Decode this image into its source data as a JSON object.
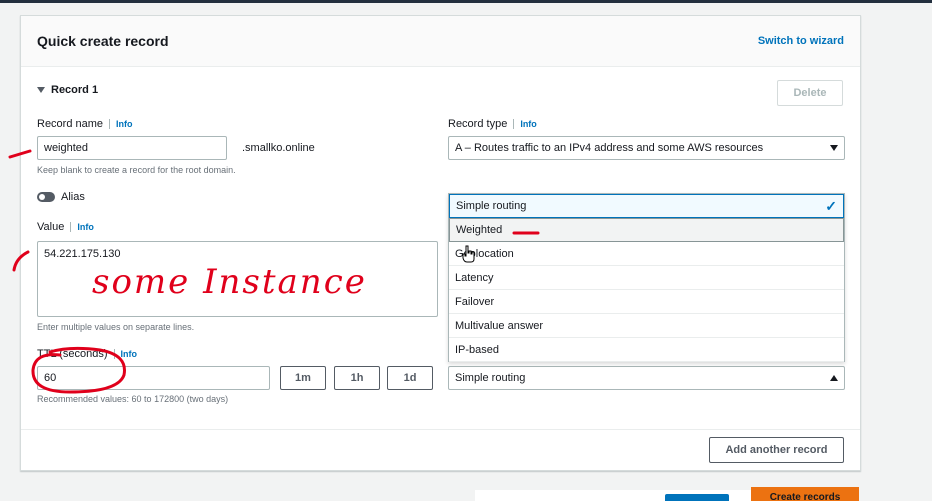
{
  "panel": {
    "title": "Quick create record",
    "switch_link": "Switch to wizard"
  },
  "record": {
    "title": "Record 1",
    "delete_label": "Delete",
    "name_label": "Record name",
    "name_info": "Info",
    "name_value": "weighted",
    "domain_suffix": ".smallko.online",
    "name_hint": "Keep blank to create a record for the root domain.",
    "type_label": "Record type",
    "type_info": "Info",
    "type_value": "A – Routes traffic to an IPv4 address and some AWS resources",
    "alias_label": "Alias",
    "value_label": "Value",
    "value_info": "Info",
    "value_text": "54.221.175.130",
    "value_hint": "Enter multiple values on separate lines.",
    "ttl_label": "TTL (seconds)",
    "ttl_info": "Info",
    "ttl_value": "60",
    "ttl_1m": "1m",
    "ttl_1h": "1h",
    "ttl_1d": "1d",
    "ttl_hint": "Recommended values: 60 to 172800 (two days)",
    "routing_value": "Simple routing"
  },
  "routing_options": [
    "Simple routing",
    "Weighted",
    "Geolocation",
    "Latency",
    "Failover",
    "Multivalue answer",
    "IP-based"
  ],
  "add_record_label": "Add another record",
  "create_label": "Create records",
  "annotation_text": "some Instance",
  "colors": {
    "link": "#0073bb",
    "primary": "#ec7211",
    "annotation": "#e0001b"
  }
}
